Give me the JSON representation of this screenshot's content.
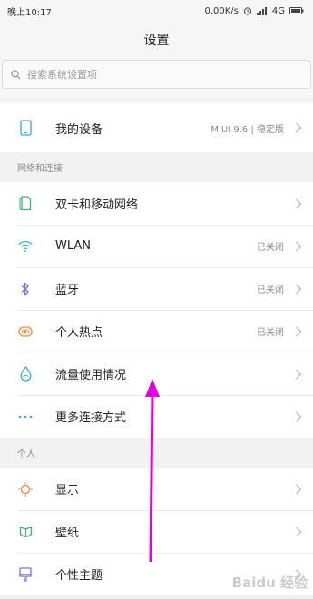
{
  "status_bar": {
    "time": "晚上10:17",
    "net_speed": "0.00K/s",
    "network": "4G"
  },
  "header": {
    "title": "设置"
  },
  "search": {
    "placeholder": "搜索系统设置项"
  },
  "device": {
    "label": "我的设备",
    "value": "MIUI 9.6 | 稳定版"
  },
  "network_section": {
    "heading": "网络和连接",
    "items": [
      {
        "label": "双卡和移动网络",
        "value": "",
        "icon": "sim-card-icon"
      },
      {
        "label": "WLAN",
        "value": "已关闭",
        "icon": "wifi-icon"
      },
      {
        "label": "蓝牙",
        "value": "已关闭",
        "icon": "bluetooth-icon"
      },
      {
        "label": "个人热点",
        "value": "已关闭",
        "icon": "hotspot-icon"
      },
      {
        "label": "流量使用情况",
        "value": "",
        "icon": "data-usage-icon"
      },
      {
        "label": "更多连接方式",
        "value": "",
        "icon": "more-dots-icon"
      }
    ]
  },
  "personal_section": {
    "heading": "个人",
    "items": [
      {
        "label": "显示",
        "icon": "display-icon"
      },
      {
        "label": "壁纸",
        "icon": "wallpaper-icon"
      },
      {
        "label": "个性主题",
        "icon": "theme-icon"
      }
    ]
  },
  "colors": {
    "annotation_arrow": "#e000e0",
    "accent": "#33aadd"
  },
  "watermark": "Baidu 经验"
}
